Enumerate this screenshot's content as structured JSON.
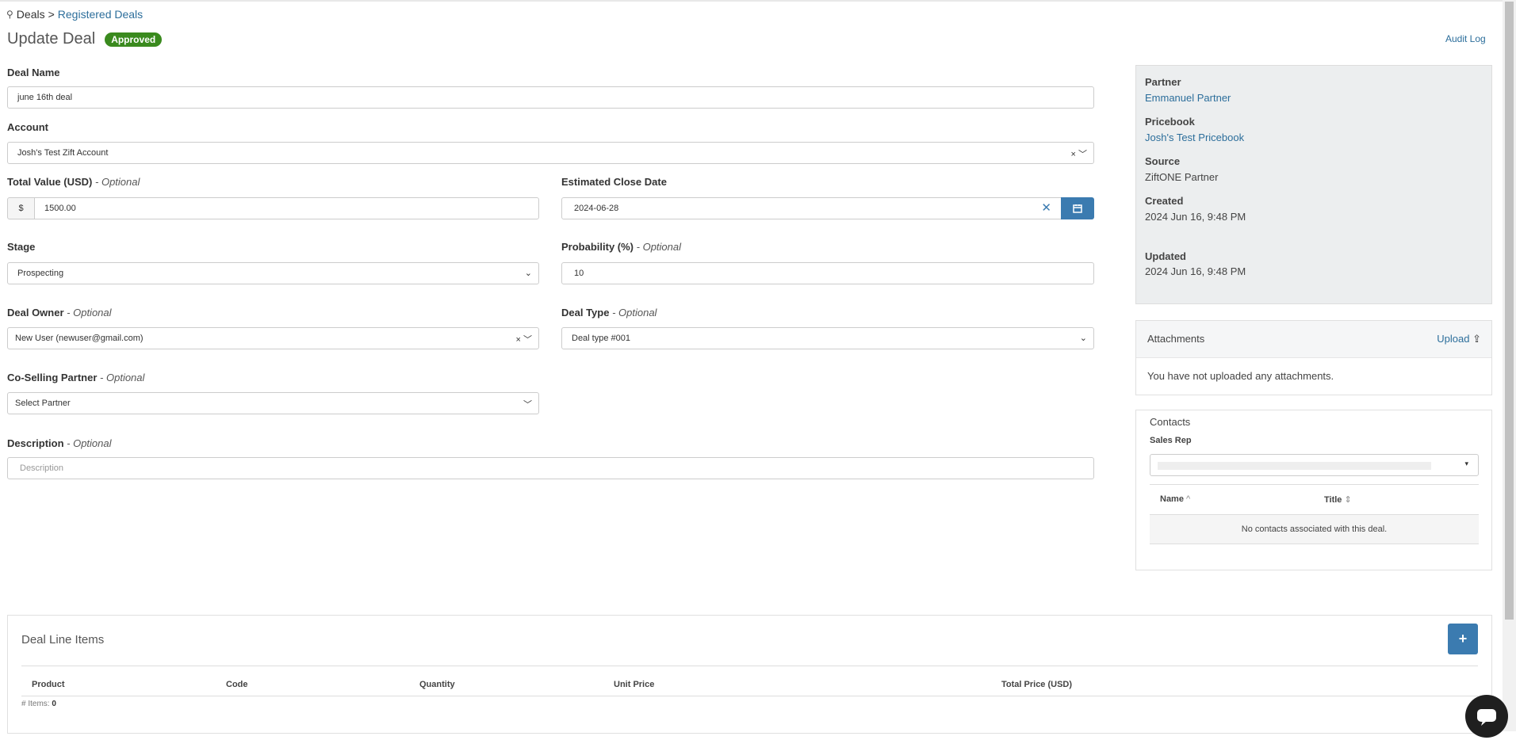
{
  "breadcrumb": {
    "root": "Deals",
    "separator": ">",
    "current": "Registered Deals"
  },
  "header": {
    "title": "Update Deal",
    "status": "Approved",
    "audit_link": "Audit Log"
  },
  "optional_suffix": "- Optional",
  "form": {
    "deal_name": {
      "label": "Deal Name",
      "value": "june 16th deal"
    },
    "account": {
      "label": "Account",
      "value": "Josh's Test Zift Account"
    },
    "total_value": {
      "label": "Total Value (USD)",
      "prefix": "$",
      "value": "1500.00"
    },
    "close_date": {
      "label": "Estimated Close Date",
      "value": "2024-06-28"
    },
    "stage": {
      "label": "Stage",
      "value": "Prospecting"
    },
    "probability": {
      "label": "Probability (%)",
      "value": "10"
    },
    "deal_owner": {
      "label": "Deal Owner",
      "value": "New User (newuser@gmail.com)"
    },
    "deal_type": {
      "label": "Deal Type",
      "value": "Deal type #001"
    },
    "co_selling": {
      "label": "Co-Selling Partner",
      "value": "Select Partner"
    },
    "description": {
      "label": "Description",
      "placeholder": "Description"
    }
  },
  "sidebar": {
    "partner_label": "Partner",
    "partner_value": "Emmanuel Partner",
    "pricebook_label": "Pricebook",
    "pricebook_value": "Josh's Test Pricebook",
    "source_label": "Source",
    "source_value": "ZiftONE Partner",
    "created_label": "Created",
    "created_value": "2024 Jun 16, 9:48 PM",
    "updated_label": "Updated",
    "updated_value": "2024 Jun 16, 9:48 PM"
  },
  "attachments": {
    "title": "Attachments",
    "upload": "Upload",
    "empty": "You have not uploaded any attachments."
  },
  "contacts": {
    "title": "Contacts",
    "sales_rep": "Sales Rep",
    "col_name": "Name",
    "col_title": "Title",
    "empty": "No contacts associated with this deal."
  },
  "line_items": {
    "title": "Deal Line Items",
    "add": "+",
    "columns": [
      "Product",
      "Code",
      "Quantity",
      "Unit Price",
      "Total Price (USD)"
    ],
    "count_label": "# Items:",
    "count": "0"
  }
}
